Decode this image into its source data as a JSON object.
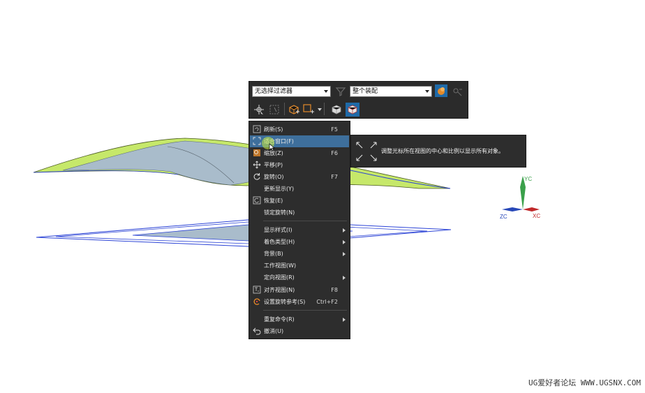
{
  "toolbar": {
    "filter_combo": "无选择过滤器",
    "scope_combo": "整个装配"
  },
  "menu": {
    "items": [
      {
        "label": "刷新(S)",
        "shortcut": "F5",
        "icon": "refresh-icon"
      },
      {
        "label": "适合窗口(F)",
        "shortcut": "",
        "icon": "fit-window-icon",
        "active": true
      },
      {
        "label": "缩放(Z)",
        "shortcut": "F6",
        "icon": "zoom-icon"
      },
      {
        "label": "平移(P)",
        "shortcut": "",
        "icon": "pan-icon"
      },
      {
        "label": "旋转(O)",
        "shortcut": "F7",
        "icon": "rotate-icon"
      },
      {
        "label": "更新显示(Y)",
        "shortcut": "",
        "icon": ""
      },
      {
        "label": "恢复(E)",
        "shortcut": "",
        "icon": "restore-icon"
      },
      {
        "label": "锁定旋转(N)",
        "shortcut": "",
        "icon": ""
      },
      {
        "label": "显示样式(I)",
        "shortcut": "",
        "icon": "",
        "submenu": true
      },
      {
        "label": "着色类型(H)",
        "shortcut": "",
        "icon": "",
        "submenu": true
      },
      {
        "label": "背景(B)",
        "shortcut": "",
        "icon": "",
        "submenu": true
      },
      {
        "label": "工作视图(W)",
        "shortcut": "",
        "icon": ""
      },
      {
        "label": "定向视图(R)",
        "shortcut": "",
        "icon": "",
        "submenu": true
      },
      {
        "label": "对齐视图(N)",
        "shortcut": "F8",
        "icon": "align-view-icon"
      },
      {
        "label": "设置旋转参考(S)",
        "shortcut": "Ctrl+F2",
        "icon": "rotate-reference-icon"
      },
      {
        "label": "重复命令(R)",
        "shortcut": "",
        "icon": "",
        "submenu": true
      },
      {
        "label": "撤消(U)",
        "shortcut": "",
        "icon": "undo-icon"
      }
    ]
  },
  "tooltip": {
    "text": "调整光标所在视图的中心和比例以显示所有对象。"
  },
  "axes": {
    "y_label": "YC",
    "x_label": "XC",
    "z_label": "ZC",
    "y_color": "#3aa04a",
    "x_color": "#c0282a",
    "z_color": "#2848b8"
  },
  "colors": {
    "surface_top": "#c6e86a",
    "surface_under": "#a9bccb",
    "wire_blue": "#2b43d6",
    "menu_highlight": "#3e6f9c",
    "panel_bg": "#2d2d2d"
  },
  "watermark": "UG爱好者论坛 WWW.UGSNX.COM"
}
